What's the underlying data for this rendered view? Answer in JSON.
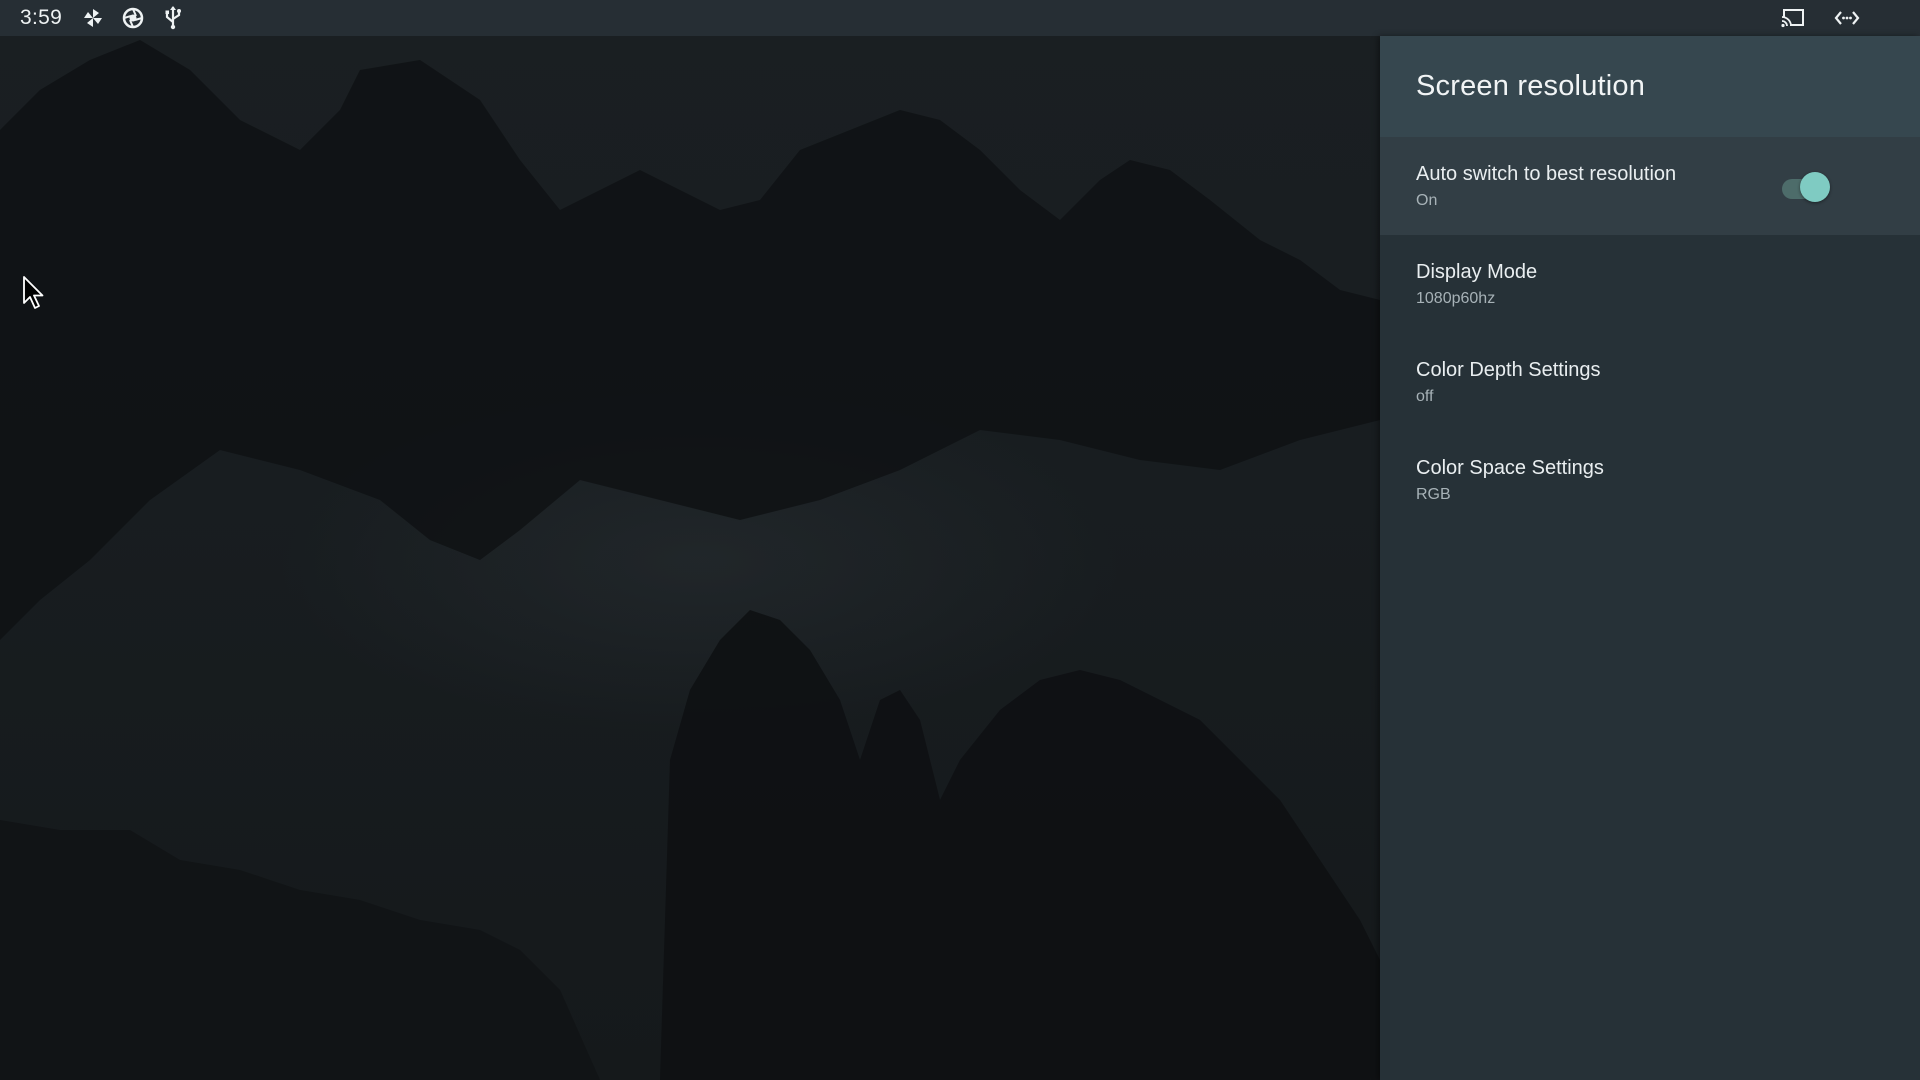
{
  "status_bar": {
    "time": "3:59",
    "left_icons": [
      "pinwheel-icon",
      "aperture-icon",
      "usb-icon"
    ],
    "right_icons": [
      "cast-icon",
      "developer-mode-icon"
    ]
  },
  "settings_panel": {
    "title": "Screen resolution",
    "items": [
      {
        "title": "Auto switch to best resolution",
        "summary": "On",
        "has_toggle": true,
        "toggle_on": true,
        "focused": true
      },
      {
        "title": "Display Mode",
        "summary": "1080p60hz"
      },
      {
        "title": "Color Depth Settings",
        "summary": "off"
      },
      {
        "title": "Color Space Settings",
        "summary": "RGB"
      }
    ]
  },
  "colors": {
    "accent": "#7fcbc2",
    "panel_bg": "#263137",
    "header_bg": "#36474f",
    "status_bar_bg": "#262e34"
  }
}
